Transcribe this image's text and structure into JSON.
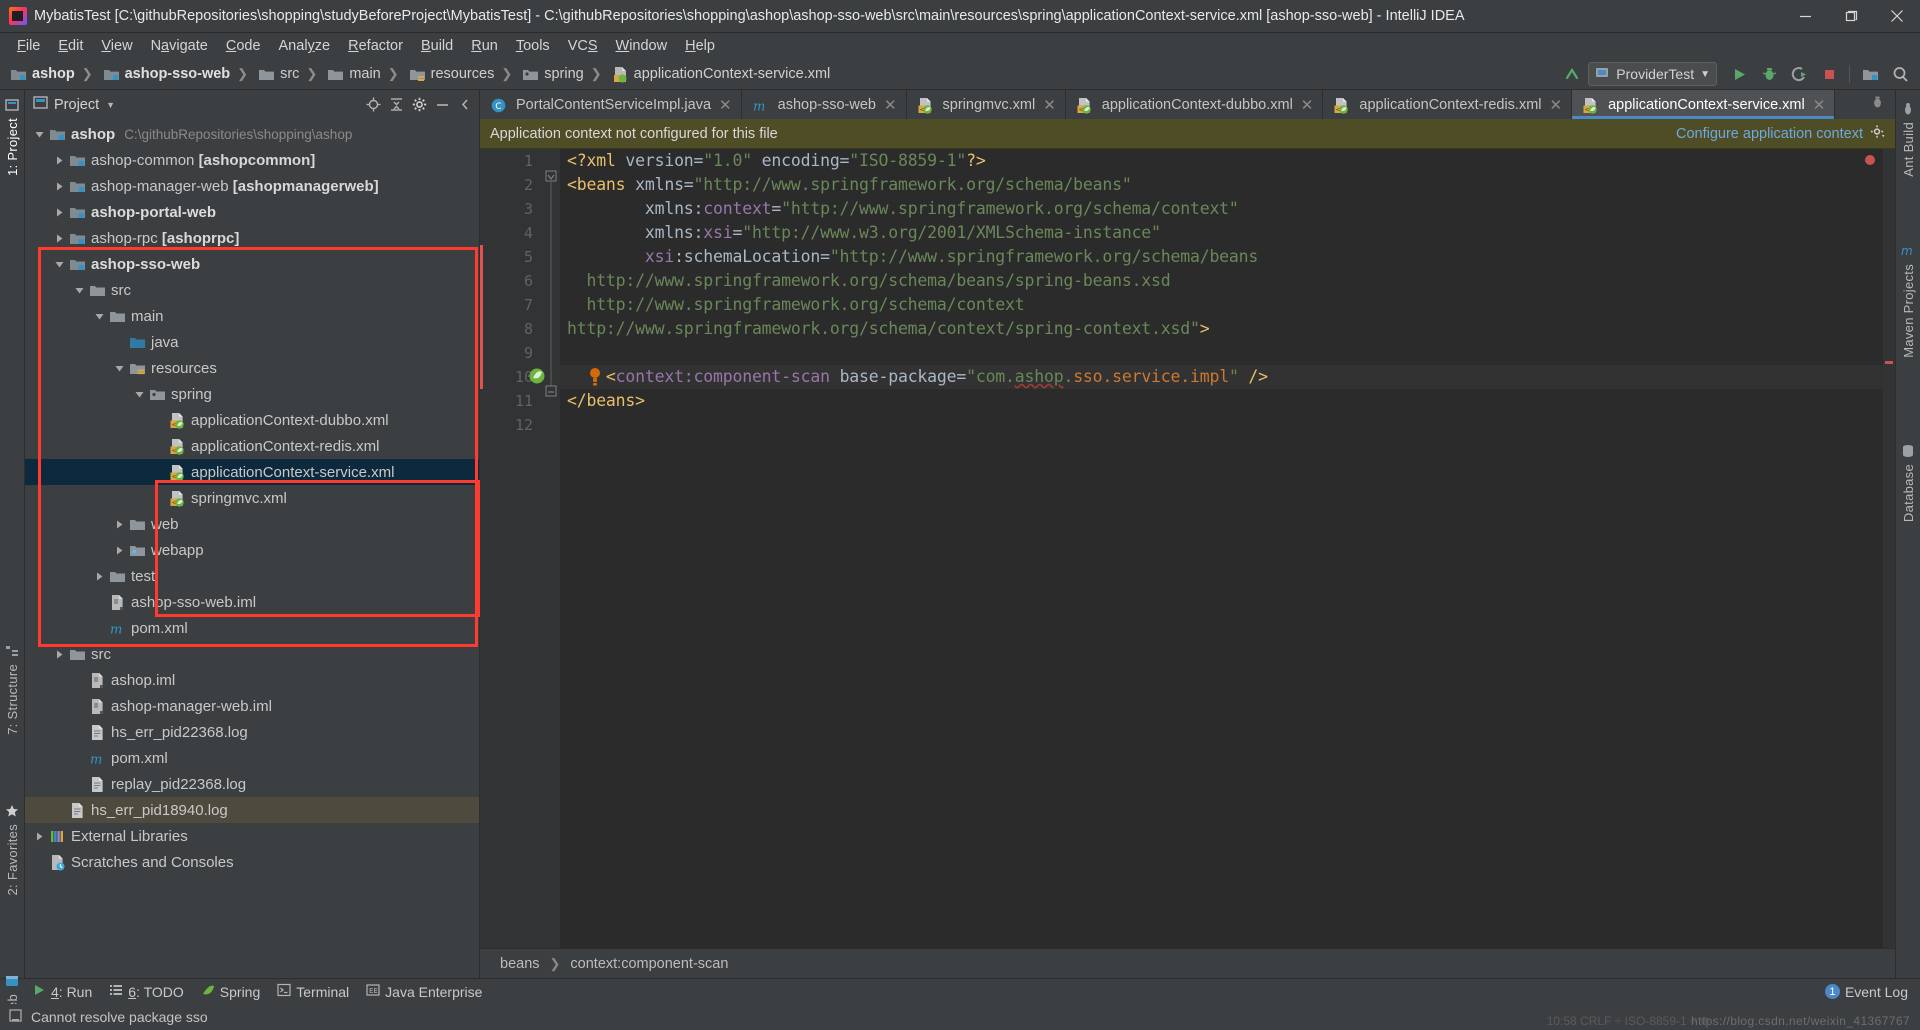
{
  "window": {
    "title": "MybatisTest [C:\\githubRepositories\\shopping\\studyBeforeProject\\MybatisTest] - C:\\githubRepositories\\shopping\\ashop\\ashop-sso-web\\src\\main\\resources\\spring\\applicationContext-service.xml [ashop-sso-web] - IntelliJ IDEA",
    "minimize_label": "Minimize",
    "maximize_label": "Restore",
    "close_label": "Close"
  },
  "menubar": {
    "items": [
      {
        "label": "File"
      },
      {
        "label": "Edit"
      },
      {
        "label": "View"
      },
      {
        "label": "Navigate"
      },
      {
        "label": "Code"
      },
      {
        "label": "Analyze"
      },
      {
        "label": "Refactor"
      },
      {
        "label": "Build"
      },
      {
        "label": "Run"
      },
      {
        "label": "Tools"
      },
      {
        "label": "VCS"
      },
      {
        "label": "Window"
      },
      {
        "label": "Help"
      }
    ]
  },
  "navbar": {
    "crumbs": [
      {
        "label": "ashop",
        "icon": "module-folder-icon",
        "bold": true
      },
      {
        "label": "ashop-sso-web",
        "icon": "module-folder-icon",
        "bold": true
      },
      {
        "label": "src",
        "icon": "folder-icon",
        "bold": false
      },
      {
        "label": "main",
        "icon": "folder-icon",
        "bold": false
      },
      {
        "label": "resources",
        "icon": "resources-folder-icon",
        "bold": false
      },
      {
        "label": "spring",
        "icon": "folder-icon",
        "bold": false
      },
      {
        "label": "applicationContext-service.xml",
        "icon": "spring-xml-icon",
        "bold": false
      }
    ],
    "run_config": "ProviderTest",
    "buttons": [
      "run-button",
      "debug-button",
      "coverage-button",
      "stop-button",
      "project-structure-button",
      "search-everywhere-button"
    ]
  },
  "left_rail": {
    "items": [
      {
        "label": "1: Project",
        "selected": true
      },
      {
        "label": "7: Structure",
        "selected": false
      },
      {
        "label": "2: Favorites",
        "selected": false
      },
      {
        "label": "Web",
        "selected": false
      }
    ]
  },
  "right_rail": {
    "items": [
      {
        "label": "Ant Build"
      },
      {
        "label": "Maven Projects"
      },
      {
        "label": "Database"
      }
    ]
  },
  "project_panel": {
    "title": "Project",
    "tools": [
      "locate-icon",
      "collapse-all-icon",
      "settings-gear-icon",
      "hide-icon",
      "minimize-icon"
    ],
    "tree": [
      {
        "depth": 0,
        "twist": "down",
        "icon": "module-folder-icon",
        "label": "ashop",
        "bold": true,
        "sub": "C:\\githubRepositories\\shopping\\ashop"
      },
      {
        "depth": 1,
        "twist": "right",
        "icon": "module-folder-icon",
        "label": "ashop-common ",
        "bold": false,
        "suffix": "[ashopcommon]"
      },
      {
        "depth": 1,
        "twist": "right",
        "icon": "module-folder-icon",
        "label": "ashop-manager-web ",
        "bold": false,
        "suffix": "[ashopmanagerweb]"
      },
      {
        "depth": 1,
        "twist": "right",
        "icon": "module-folder-icon",
        "label": "ashop-portal-web",
        "bold": true
      },
      {
        "depth": 1,
        "twist": "right",
        "icon": "module-folder-icon",
        "label": "ashop-rpc ",
        "bold": false,
        "suffix": "[ashoprpc]"
      },
      {
        "depth": 1,
        "twist": "down",
        "icon": "module-folder-icon",
        "label": "ashop-sso-web",
        "bold": true
      },
      {
        "depth": 2,
        "twist": "down",
        "icon": "folder-icon",
        "label": "src",
        "bold": false
      },
      {
        "depth": 3,
        "twist": "down",
        "icon": "folder-icon",
        "label": "main",
        "bold": false
      },
      {
        "depth": 4,
        "twist": "none",
        "icon": "source-folder-icon",
        "label": "java",
        "bold": false
      },
      {
        "depth": 4,
        "twist": "down",
        "icon": "resources-folder-icon",
        "label": "resources",
        "bold": false
      },
      {
        "depth": 5,
        "twist": "down",
        "icon": "spring-folder-icon",
        "label": "spring",
        "bold": false
      },
      {
        "depth": 6,
        "twist": "none",
        "icon": "spring-xml-icon",
        "label": "applicationContext-dubbo.xml",
        "bold": false
      },
      {
        "depth": 6,
        "twist": "none",
        "icon": "spring-xml-icon",
        "label": "applicationContext-redis.xml",
        "bold": false
      },
      {
        "depth": 6,
        "twist": "none",
        "icon": "spring-xml-icon",
        "label": "applicationContext-service.xml",
        "bold": false,
        "selected": true
      },
      {
        "depth": 6,
        "twist": "none",
        "icon": "spring-xml-icon",
        "label": "springmvc.xml",
        "bold": false
      },
      {
        "depth": 4,
        "twist": "right",
        "icon": "folder-icon",
        "label": "web",
        "bold": false
      },
      {
        "depth": 4,
        "twist": "right",
        "icon": "webapp-folder-icon",
        "label": "webapp",
        "bold": false
      },
      {
        "depth": 3,
        "twist": "right",
        "icon": "folder-icon",
        "label": "test",
        "bold": false
      },
      {
        "depth": 3,
        "twist": "none",
        "icon": "iml-file-icon",
        "label": "ashop-sso-web.iml",
        "bold": false
      },
      {
        "depth": 3,
        "twist": "none",
        "icon": "maven-icon",
        "label": "pom.xml",
        "bold": false
      },
      {
        "depth": 1,
        "twist": "right",
        "icon": "folder-icon",
        "label": "src",
        "bold": false
      },
      {
        "depth": 2,
        "twist": "none",
        "icon": "iml-file-icon",
        "label": "ashop.iml",
        "bold": false
      },
      {
        "depth": 2,
        "twist": "none",
        "icon": "iml-file-icon",
        "label": "ashop-manager-web.iml",
        "bold": false
      },
      {
        "depth": 2,
        "twist": "none",
        "icon": "log-file-icon",
        "label": "hs_err_pid22368.log",
        "bold": false
      },
      {
        "depth": 2,
        "twist": "none",
        "icon": "maven-icon",
        "label": "pom.xml",
        "bold": false
      },
      {
        "depth": 2,
        "twist": "none",
        "icon": "log-file-icon",
        "label": "replay_pid22368.log",
        "bold": false
      },
      {
        "depth": 1,
        "twist": "none",
        "icon": "log-file-icon",
        "label": "hs_err_pid18940.log",
        "bold": false,
        "highlighted": true
      },
      {
        "depth": 0,
        "twist": "right",
        "icon": "external-libraries-icon",
        "label": "External Libraries",
        "bold": false
      },
      {
        "depth": 0,
        "twist": "none",
        "icon": "scratches-icon",
        "label": "Scratches and Consoles",
        "bold": false
      }
    ]
  },
  "editor": {
    "tabs": [
      {
        "label": "PortalContentServiceImpl.java",
        "icon": "java-class-icon",
        "active": false,
        "closable": true
      },
      {
        "label": "ashop-sso-web",
        "icon": "maven-icon",
        "active": false,
        "closable": true
      },
      {
        "label": "springmvc.xml",
        "icon": "spring-xml-icon",
        "active": false,
        "closable": true
      },
      {
        "label": "applicationContext-dubbo.xml",
        "icon": "spring-xml-icon",
        "active": false,
        "closable": true
      },
      {
        "label": "applicationContext-redis.xml",
        "icon": "spring-xml-icon",
        "active": false,
        "closable": true
      },
      {
        "label": "applicationContext-service.xml",
        "icon": "spring-xml-icon",
        "active": true,
        "closable": true
      }
    ],
    "notification": {
      "message": "Application context not configured for this file",
      "action": "Configure application context",
      "gear": "gear-icon"
    },
    "line_numbers": [
      "1",
      "2",
      "3",
      "4",
      "5",
      "6",
      "7",
      "8",
      "9",
      "10",
      "11",
      "12"
    ],
    "code_lines": [
      {
        "n": 1,
        "segments": [
          {
            "t": "<?xml ",
            "c": "pi"
          },
          {
            "t": "version=",
            "c": "plain"
          },
          {
            "t": "\"1.0\"",
            "c": "str"
          },
          {
            "t": " encoding=",
            "c": "plain"
          },
          {
            "t": "\"ISO-8859-1\"",
            "c": "str"
          },
          {
            "t": "?>",
            "c": "pi"
          }
        ]
      },
      {
        "n": 2,
        "segments": [
          {
            "t": "<beans ",
            "c": "tag"
          },
          {
            "t": "xmlns=",
            "c": "plain"
          },
          {
            "t": "\"http://www.springframework.org/schema/beans\"",
            "c": "str"
          }
        ]
      },
      {
        "n": 3,
        "segments": [
          {
            "t": "        xmlns:",
            "c": "plain"
          },
          {
            "t": "context",
            "c": "attr"
          },
          {
            "t": "=",
            "c": "plain"
          },
          {
            "t": "\"http://www.springframework.org/schema/context\"",
            "c": "str"
          }
        ]
      },
      {
        "n": 4,
        "segments": [
          {
            "t": "        xmlns:",
            "c": "plain"
          },
          {
            "t": "xsi",
            "c": "attr"
          },
          {
            "t": "=",
            "c": "plain"
          },
          {
            "t": "\"http://www.w3.org/2001/XMLSchema-instance\"",
            "c": "str"
          }
        ]
      },
      {
        "n": 5,
        "segments": [
          {
            "t": "        ",
            "c": "plain"
          },
          {
            "t": "xsi",
            "c": "attr"
          },
          {
            "t": ":schemaLocation=",
            "c": "plain"
          },
          {
            "t": "\"http://www.springframework.org/schema/beans",
            "c": "str"
          }
        ]
      },
      {
        "n": 6,
        "segments": [
          {
            "t": "  http://www.springframework.org/schema/beans/spring-beans.xsd",
            "c": "str"
          }
        ]
      },
      {
        "n": 7,
        "segments": [
          {
            "t": "  http://www.springframework.org/schema/context",
            "c": "str"
          }
        ]
      },
      {
        "n": 8,
        "segments": [
          {
            "t": "http://www.springframework.org/schema/context/spring-context.xsd\"",
            "c": "str"
          },
          {
            "t": ">",
            "c": "tag"
          }
        ]
      },
      {
        "n": 9,
        "segments": []
      },
      {
        "n": 10,
        "segments": [
          {
            "t": "    <",
            "c": "tag"
          },
          {
            "t": "context:component-scan ",
            "c": "attr"
          },
          {
            "t": "base-package=",
            "c": "plain"
          },
          {
            "t": "\"com.",
            "c": "str"
          },
          {
            "t": "ashop",
            "c": "str-err"
          },
          {
            "t": ".",
            "c": "str"
          },
          {
            "t": "sso.service.impl",
            "c": "err"
          },
          {
            "t": "\"",
            "c": "str"
          },
          {
            "t": " />",
            "c": "tag"
          }
        ]
      },
      {
        "n": 11,
        "segments": [
          {
            "t": "</beans>",
            "c": "tag"
          }
        ]
      },
      {
        "n": 12,
        "segments": []
      }
    ],
    "breadcrumbs": [
      "beans",
      "context:component-scan"
    ]
  },
  "bottom_toolwindows": {
    "items": [
      {
        "label": "4: Run",
        "icon": "run-icon",
        "mnemonic": "4"
      },
      {
        "label": "6: TODO",
        "icon": "todo-icon",
        "mnemonic": "6"
      },
      {
        "label": "Spring",
        "icon": "spring-leaf-icon"
      },
      {
        "label": "Terminal",
        "icon": "terminal-icon"
      },
      {
        "label": "Java Enterprise",
        "icon": "java-ee-icon"
      }
    ],
    "event_log": {
      "label": "Event Log",
      "count": "1"
    }
  },
  "statusbar": {
    "message": "Cannot resolve package sso",
    "icon": "status-info-icon",
    "watermark": "https://blog.csdn.net/weixin_41367767"
  }
}
